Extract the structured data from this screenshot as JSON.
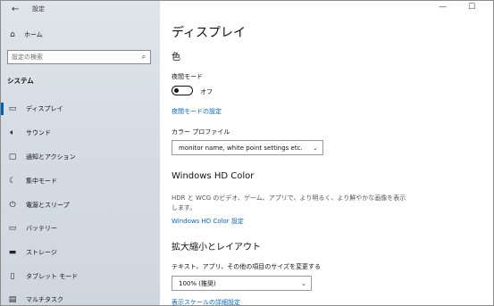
{
  "app": {
    "title": "設定"
  },
  "sidebar": {
    "home_label": "ホーム",
    "search_placeholder": "設定の検索",
    "section_title": "システム",
    "items": [
      {
        "label": "ディスプレイ",
        "icon": "monitor-icon",
        "active": true
      },
      {
        "label": "サウンド",
        "icon": "speaker-icon"
      },
      {
        "label": "通知とアクション",
        "icon": "notification-icon"
      },
      {
        "label": "集中モード",
        "icon": "moon-icon"
      },
      {
        "label": "電源とスリープ",
        "icon": "power-icon"
      },
      {
        "label": "バッテリー",
        "icon": "battery-icon"
      },
      {
        "label": "ストレージ",
        "icon": "storage-icon"
      },
      {
        "label": "タブレット モード",
        "icon": "tablet-icon"
      },
      {
        "label": "マルチタスク",
        "icon": "multitask-icon"
      }
    ]
  },
  "main": {
    "title": "ディスプレイ",
    "color_heading": "色",
    "night_light": {
      "label": "夜間モード",
      "state": "オフ",
      "settings_link": "夜間モードの設定"
    },
    "color_profile": {
      "label": "カラー プロファイル",
      "value": "monitor name, white point settings etc."
    },
    "hd_color": {
      "heading": "Windows HD Color",
      "description": "HDR と WCG のビデオ、ゲーム、アプリで、より明るく、より鮮やかな画像を表示します。",
      "link": "Windows HD Color 設定"
    },
    "scale": {
      "heading": "拡大縮小とレイアウト",
      "label": "テキスト、アプリ、その他の項目のサイズを変更する",
      "value": "100% (推奨)",
      "advanced_link": "表示スケールの詳細設定"
    }
  },
  "colors": {
    "accent": "#0067c0",
    "sidebar_bg": "#d6dde4"
  }
}
